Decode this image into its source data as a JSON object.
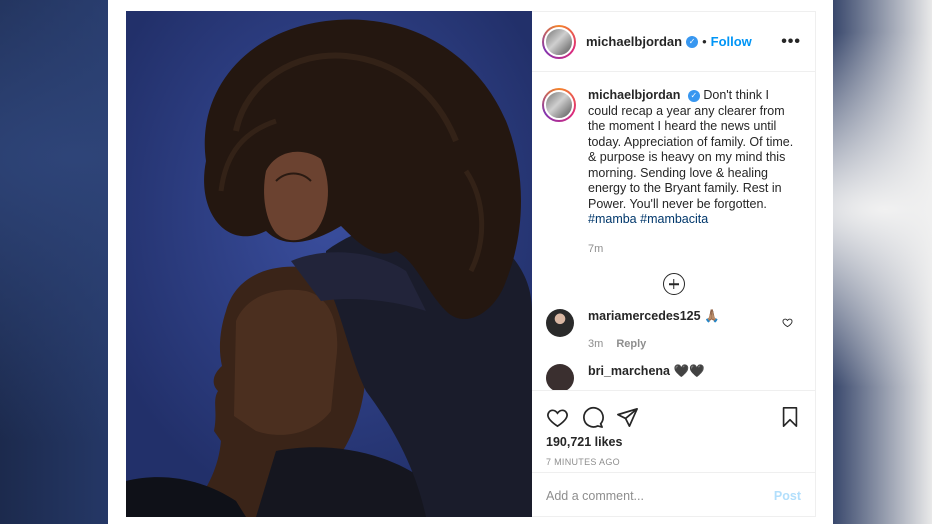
{
  "post": {
    "author": "michaelbjordan",
    "follow_label": "Follow",
    "separator": "•",
    "more_label": "•••",
    "caption": {
      "username": "michaelbjordan",
      "text": "Don't think I could recap a year any clearer from the moment I heard the news until today. Appreciation of family. Of time. & purpose is heavy on my mind this morning. Sending love & healing energy to the Bryant family. Rest in Power. You'll never be forgotten.",
      "hashtags": [
        "#mamba",
        "#mambacita"
      ],
      "time": "7m"
    },
    "comments": [
      {
        "username": "mariamercedes125",
        "text": "🙏🏽",
        "time": "3m",
        "reply_label": "Reply"
      },
      {
        "username": "bri_marchena",
        "text": "🖤🖤",
        "time": "",
        "reply_label": ""
      }
    ],
    "likes": "190,721 likes",
    "time_ago": "7 MINUTES AGO",
    "comment_placeholder": "Add a comment...",
    "post_label": "Post"
  },
  "icons": {
    "verified": "verified-badge-icon",
    "load_more": "plus-circle-icon",
    "like": "heart-icon",
    "comment": "comment-icon",
    "share": "paper-plane-icon",
    "save": "bookmark-icon"
  },
  "colors": {
    "link": "#0095f6",
    "hashtag": "#00376b",
    "muted": "#8e8e8e",
    "post_disabled": "#b2dffc"
  }
}
